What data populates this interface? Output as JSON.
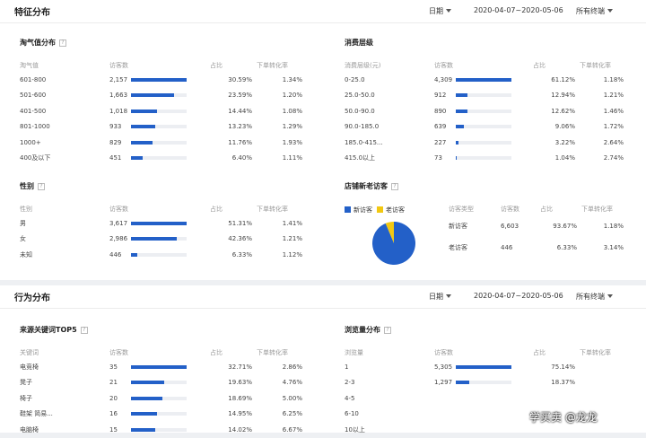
{
  "section1": {
    "title": "特征分布",
    "date_label": "日期",
    "range": "2020-04-07~2020-05-06",
    "terminal": "所有终端"
  },
  "section2": {
    "title": "行为分布",
    "date_label": "日期",
    "range": "2020-04-07~2020-05-06",
    "terminal": "所有终端"
  },
  "taoqi": {
    "title": "淘气值分布",
    "headers": [
      "淘气值",
      "访客数",
      "占比",
      "下单转化率"
    ],
    "rows": [
      {
        "label": "601-800",
        "visitors": "2,157",
        "bar": 1.0,
        "share": "30.59%",
        "conv": "1.34%"
      },
      {
        "label": "501-600",
        "visitors": "1,663",
        "bar": 0.77,
        "share": "23.59%",
        "conv": "1.20%"
      },
      {
        "label": "401-500",
        "visitors": "1,018",
        "bar": 0.47,
        "share": "14.44%",
        "conv": "1.08%"
      },
      {
        "label": "801-1000",
        "visitors": "933",
        "bar": 0.43,
        "share": "13.23%",
        "conv": "1.29%"
      },
      {
        "label": "1000+",
        "visitors": "829",
        "bar": 0.38,
        "share": "11.76%",
        "conv": "1.93%"
      },
      {
        "label": "400及以下",
        "visitors": "451",
        "bar": 0.21,
        "share": "6.40%",
        "conv": "1.11%"
      }
    ]
  },
  "consume": {
    "title": "消费层级",
    "headers": [
      "消费层级(元)",
      "访客数",
      "占比",
      "下单转化率"
    ],
    "rows": [
      {
        "label": "0-25.0",
        "visitors": "4,309",
        "bar": 1.0,
        "share": "61.12%",
        "conv": "1.18%"
      },
      {
        "label": "25.0-50.0",
        "visitors": "912",
        "bar": 0.21,
        "share": "12.94%",
        "conv": "1.21%"
      },
      {
        "label": "50.0-90.0",
        "visitors": "890",
        "bar": 0.21,
        "share": "12.62%",
        "conv": "1.46%"
      },
      {
        "label": "90.0-185.0",
        "visitors": "639",
        "bar": 0.15,
        "share": "9.06%",
        "conv": "1.72%"
      },
      {
        "label": "185.0-415...",
        "visitors": "227",
        "bar": 0.05,
        "share": "3.22%",
        "conv": "2.64%"
      },
      {
        "label": "415.0以上",
        "visitors": "73",
        "bar": 0.02,
        "share": "1.04%",
        "conv": "2.74%"
      }
    ]
  },
  "gender": {
    "title": "性别",
    "headers": [
      "性别",
      "访客数",
      "占比",
      "下单转化率"
    ],
    "rows": [
      {
        "label": "男",
        "visitors": "3,617",
        "bar": 1.0,
        "share": "51.31%",
        "conv": "1.41%"
      },
      {
        "label": "女",
        "visitors": "2,986",
        "bar": 0.83,
        "share": "42.36%",
        "conv": "1.21%"
      },
      {
        "label": "未知",
        "visitors": "446",
        "bar": 0.12,
        "share": "6.33%",
        "conv": "1.12%"
      }
    ]
  },
  "newold": {
    "title": "店铺新老访客",
    "legend": [
      {
        "label": "新访客",
        "color": "#2360c8"
      },
      {
        "label": "老访客",
        "color": "#f2c811"
      }
    ],
    "pie_new_share": 0.9367,
    "headers": [
      "访客类型",
      "访客数",
      "占比",
      "下单转化率"
    ],
    "rows": [
      {
        "label": "新访客",
        "visitors": "6,603",
        "share": "93.67%",
        "conv": "1.18%"
      },
      {
        "label": "老访客",
        "visitors": "446",
        "share": "6.33%",
        "conv": "3.14%"
      }
    ]
  },
  "keywords": {
    "title": "来源关键词TOP5",
    "headers": [
      "关键词",
      "访客数",
      "占比",
      "下单转化率"
    ],
    "rows": [
      {
        "label": "电竞椅",
        "visitors": "35",
        "bar": 1.0,
        "share": "32.71%",
        "conv": "2.86%"
      },
      {
        "label": "凳子",
        "visitors": "21",
        "bar": 0.6,
        "share": "19.63%",
        "conv": "4.76%"
      },
      {
        "label": "椅子",
        "visitors": "20",
        "bar": 0.57,
        "share": "18.69%",
        "conv": "5.00%"
      },
      {
        "label": "鞋架 简易...",
        "visitors": "16",
        "bar": 0.46,
        "share": "14.95%",
        "conv": "6.25%"
      },
      {
        "label": "电脑椅",
        "visitors": "15",
        "bar": 0.43,
        "share": "14.02%",
        "conv": "6.67%"
      }
    ]
  },
  "browse": {
    "title": "浏览量分布",
    "headers": [
      "浏览量",
      "访客数",
      "占比",
      "下单转化率"
    ],
    "rows": [
      {
        "label": "1",
        "visitors": "5,305",
        "bar": 1.0,
        "share": "75.14%",
        "conv": ""
      },
      {
        "label": "2-3",
        "visitors": "1,297",
        "bar": 0.24,
        "share": "18.37%",
        "conv": ""
      },
      {
        "label": "4-5",
        "visitors": "",
        "bar": 0,
        "share": "",
        "conv": ""
      },
      {
        "label": "6-10",
        "visitors": "",
        "bar": 0,
        "share": "",
        "conv": ""
      },
      {
        "label": "10以上",
        "visitors": "",
        "bar": 0,
        "share": "",
        "conv": ""
      }
    ]
  },
  "watermark": "学买卖 @龙龙"
}
